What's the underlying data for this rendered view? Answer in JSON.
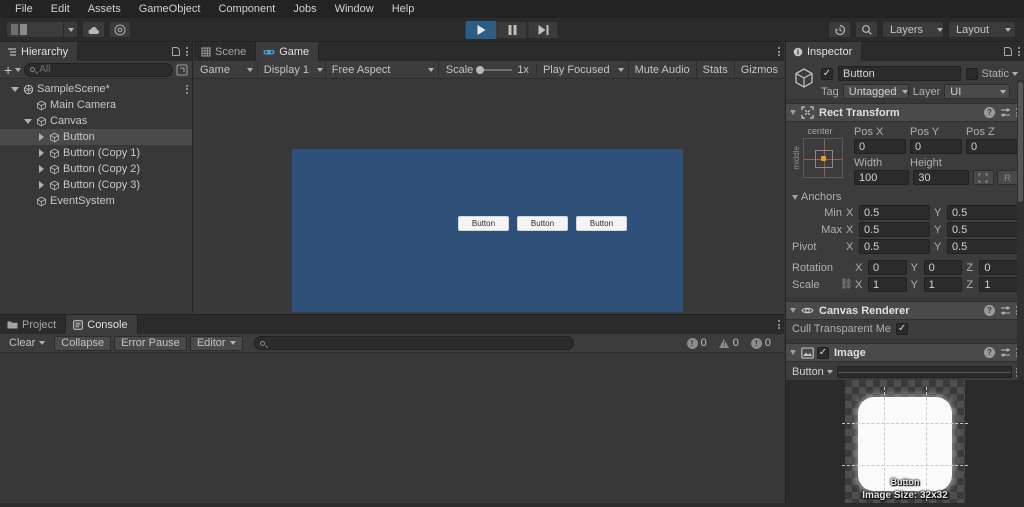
{
  "menubar": {
    "items": [
      {
        "label": "File"
      },
      {
        "label": "Edit"
      },
      {
        "label": "Assets"
      },
      {
        "label": "GameObject"
      },
      {
        "label": "Component"
      },
      {
        "label": "Jobs"
      },
      {
        "label": "Window"
      },
      {
        "label": "Help"
      }
    ]
  },
  "toolbar": {
    "cloud_icon": "cloud-icon",
    "services_icon": "unity-services-icon",
    "account_caret": "chevron-down-icon",
    "play_icon": "play-icon",
    "pause_icon": "pause-icon",
    "step_icon": "step-icon",
    "play_active": true,
    "history_icon": "history-icon",
    "search_icon": "search-icon",
    "layers_label": "Layers",
    "layout_label": "Layout"
  },
  "hierarchy": {
    "tab_label": "Hierarchy",
    "tab_icon": "hierarchy-icon",
    "add_label": "+",
    "search_placeholder": "All",
    "items": [
      {
        "label": "SampleScene*",
        "depth": 0,
        "arrow": "down",
        "icon": "scene-icon",
        "selected": false,
        "kebab": true
      },
      {
        "label": "Main Camera",
        "depth": 1,
        "arrow": "none",
        "icon": "gameobject-icon",
        "selected": false,
        "kebab": false
      },
      {
        "label": "Canvas",
        "depth": 1,
        "arrow": "down",
        "icon": "gameobject-icon",
        "selected": false,
        "kebab": false
      },
      {
        "label": "Button",
        "depth": 2,
        "arrow": "right",
        "icon": "gameobject-icon",
        "selected": true,
        "kebab": false
      },
      {
        "label": "Button (Copy 1)",
        "depth": 2,
        "arrow": "right",
        "icon": "gameobject-icon",
        "selected": false,
        "kebab": false
      },
      {
        "label": "Button (Copy 2)",
        "depth": 2,
        "arrow": "right",
        "icon": "gameobject-icon",
        "selected": false,
        "kebab": false
      },
      {
        "label": "Button (Copy 3)",
        "depth": 2,
        "arrow": "right",
        "icon": "gameobject-icon",
        "selected": false,
        "kebab": false
      },
      {
        "label": "EventSystem",
        "depth": 1,
        "arrow": "none",
        "icon": "gameobject-icon",
        "selected": false,
        "kebab": false
      }
    ]
  },
  "gameview": {
    "tabs": [
      {
        "label": "Scene",
        "icon": "scene-tab-icon",
        "active": false
      },
      {
        "label": "Game",
        "icon": "game-tab-icon",
        "active": true
      }
    ],
    "toolbar": {
      "target_label": "Game",
      "display_label": "Display 1",
      "aspect_label": "Free Aspect",
      "scale_label": "Scale",
      "scale_value": "1x",
      "play_mode_label": "Play Focused",
      "mute_audio_label": "Mute Audio",
      "stats_label": "Stats",
      "gizmos_label": "Gizmos"
    },
    "screen_bg": "#2f5079",
    "buttons": [
      {
        "label": "Button"
      },
      {
        "label": "Button"
      },
      {
        "label": "Button"
      }
    ]
  },
  "console": {
    "tabs": [
      {
        "label": "Project",
        "icon": "folder-icon",
        "active": false
      },
      {
        "label": "Console",
        "icon": "console-icon",
        "active": true
      }
    ],
    "toolbar": {
      "clear_label": "Clear",
      "collapse_label": "Collapse",
      "error_pause_label": "Error Pause",
      "editor_label": "Editor",
      "search_placeholder": ""
    },
    "counters": {
      "log_count": "0",
      "warning_count": "0",
      "error_count": "0"
    }
  },
  "inspector": {
    "tab_label": "Inspector",
    "tab_icon": "inspector-icon",
    "object": {
      "enabled": true,
      "name": "Button",
      "static_label": "Static",
      "static_checked": false,
      "tag_label": "Tag",
      "tag_value": "Untagged",
      "layer_label": "Layer",
      "layer_value": "UI"
    },
    "rect_transform": {
      "title": "Rect Transform",
      "icon": "rect-transform-icon",
      "anchor_preset_h": "center",
      "anchor_preset_v": "middle",
      "pos_x_label": "Pos X",
      "pos_y_label": "Pos Y",
      "pos_z_label": "Pos Z",
      "pos_x": "0",
      "pos_y": "0",
      "pos_z": "0",
      "width_label": "Width",
      "height_label": "Height",
      "width": "100",
      "height": "30",
      "blueprint_icon": "blueprint-icon",
      "rawedit_label": "R",
      "anchors_label": "Anchors",
      "min_label": "Min",
      "max_label": "Max",
      "pivot_label": "Pivot",
      "anchor_min_x": "0.5",
      "anchor_min_y": "0.5",
      "anchor_max_x": "0.5",
      "anchor_max_y": "0.5",
      "pivot_x": "0.5",
      "pivot_y": "0.5",
      "rotation_label": "Rotation",
      "rot_x": "0",
      "rot_y": "0",
      "rot_z": "0",
      "scale_label": "Scale",
      "scale_x": "1",
      "scale_y": "1",
      "scale_z": "1",
      "axis_x": "X",
      "axis_y": "Y",
      "axis_z": "Z",
      "link_icon": "link-broken-icon"
    },
    "canvas_renderer": {
      "title": "Canvas Renderer",
      "icon": "eye-icon",
      "cull_label": "Cull Transparent Me",
      "cull_checked": true
    },
    "image": {
      "title": "Image",
      "icon": "image-icon",
      "enabled": true,
      "source_value": "Button",
      "preview_caption": "Button",
      "preview_size": "Image Size: 32x32"
    }
  }
}
